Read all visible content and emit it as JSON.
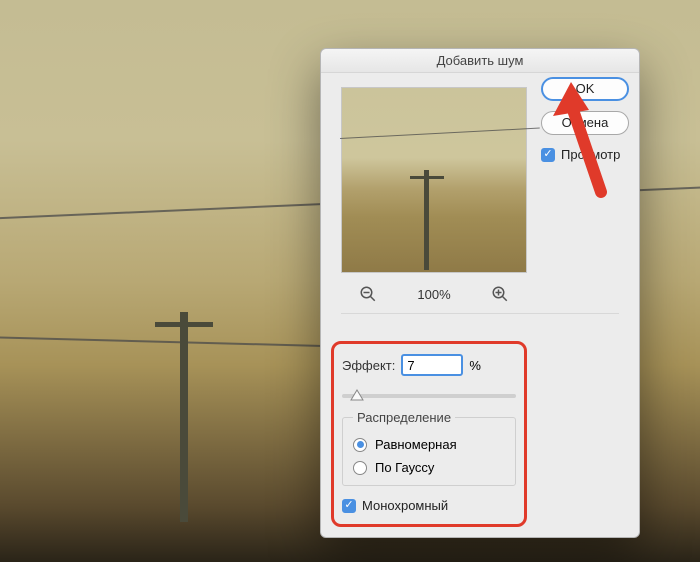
{
  "dialog": {
    "title": "Добавить шум",
    "ok_label": "OK",
    "cancel_label": "Отмена",
    "preview_label": "Просмотр",
    "preview_checked": true,
    "zoom_text": "100%"
  },
  "effect": {
    "label": "Эффект:",
    "value": "7",
    "unit": "%"
  },
  "distribution": {
    "legend": "Распределение",
    "options": [
      {
        "label": "Равномерная",
        "selected": true
      },
      {
        "label": "По Гауссу",
        "selected": false
      }
    ]
  },
  "monochrome": {
    "label": "Монохромный",
    "checked": true
  }
}
